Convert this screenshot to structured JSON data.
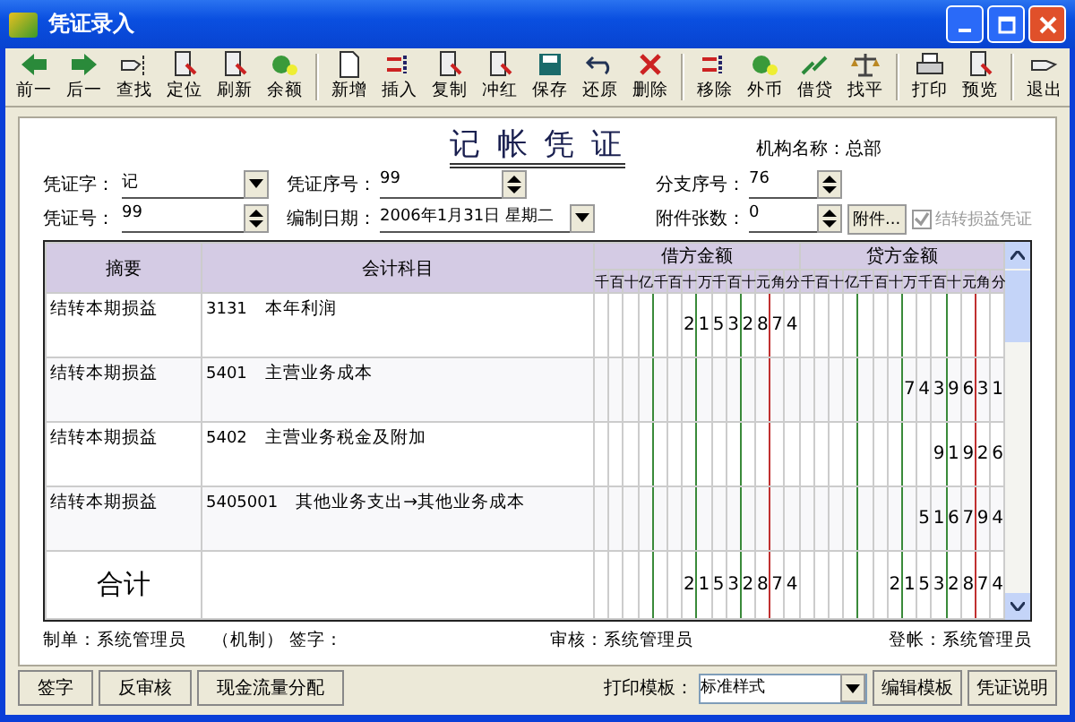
{
  "window": {
    "title": "凭证录入"
  },
  "toolbar": [
    [
      "前一",
      "后一",
      "查找",
      "定位",
      "刷新",
      "余额"
    ],
    [
      "新增",
      "插入",
      "复制",
      "冲红",
      "保存",
      "还原",
      "删除"
    ],
    [
      "移除",
      "外币",
      "借贷",
      "找平"
    ],
    [
      "打印",
      "预览"
    ],
    [
      "退出"
    ]
  ],
  "voucher": {
    "title": "记 帐 凭 证",
    "org_label": "机构名称：",
    "org": "总部",
    "fields": [
      {
        "label": "凭证字：",
        "value": "记",
        "kind": "dropdown"
      },
      {
        "label": "凭证序号：",
        "value": "99",
        "kind": "spin"
      },
      {
        "label": "分支序号：",
        "value": "76",
        "kind": "spin"
      },
      {
        "label": "凭证号：",
        "value": "99",
        "kind": "spin"
      },
      {
        "label": "编制日期：",
        "value": "2006年1月31日  星期二",
        "kind": "dropdown"
      },
      {
        "label": "附件张数：",
        "value": "0",
        "kind": "spin"
      }
    ],
    "attach_button": "附件...",
    "carry_checkbox": {
      "label": "结转损益凭证",
      "checked": true,
      "disabled": true
    }
  },
  "table": {
    "columns": [
      "摘要",
      "会计科目",
      "借方金额",
      "贷方金额"
    ],
    "debit_units": [
      "千",
      "百",
      "十",
      "亿",
      "千",
      "百",
      "十",
      "万",
      "千",
      "百",
      "十",
      "元",
      "角",
      "分"
    ],
    "credit_units": [
      "千",
      "百",
      "十",
      "亿",
      "千",
      "百",
      "十",
      "万",
      "千",
      "百",
      "十",
      "元",
      "角",
      "分"
    ],
    "rows": [
      {
        "summary": "结转本期损益",
        "code": "3131",
        "account": "本年利润",
        "debit": "21532874",
        "credit": ""
      },
      {
        "summary": "结转本期损益",
        "code": "5401",
        "account": "主营业务成本",
        "debit": "",
        "credit": "7439631"
      },
      {
        "summary": "结转本期损益",
        "code": "5402",
        "account": "主营业务税金及附加",
        "debit": "",
        "credit": "91926"
      },
      {
        "summary": "结转本期损益",
        "code": "5405001",
        "account": "其他业务支出→其他业务成本",
        "debit": "",
        "credit": "516794"
      }
    ],
    "total": {
      "label": "合计",
      "debit": "21532874",
      "credit": "21532874"
    }
  },
  "signatures": [
    {
      "label": "制单：",
      "value": "系统管理员"
    },
    {
      "label": "（机制）  签字："
    },
    {
      "label": "审核：",
      "value": "系统管理员"
    },
    {
      "label": "登帐：",
      "value": "系统管理员"
    }
  ],
  "buttons": [
    "签字",
    "反审核",
    "现金流量分配"
  ],
  "print_template": {
    "label": "打印模板：",
    "value": "标准样式"
  },
  "right_buttons": [
    "编辑模板",
    "凭证说明"
  ]
}
